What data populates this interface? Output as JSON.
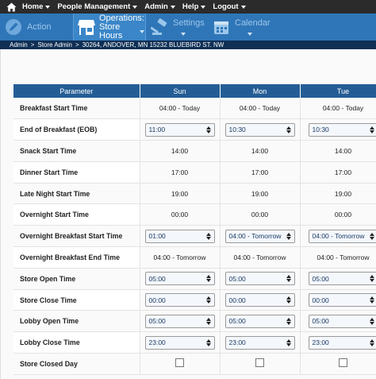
{
  "menu": {
    "home_icon": "home-icon",
    "items": [
      {
        "label": "Home",
        "has_caret": true
      },
      {
        "label": "People Management",
        "has_caret": true
      },
      {
        "label": "Admin",
        "has_caret": true
      },
      {
        "label": "Help",
        "has_caret": true
      },
      {
        "label": "Logout",
        "has_caret": true
      }
    ]
  },
  "toolbar": {
    "action_label": "Action",
    "operations_label_1": "Operations:",
    "operations_label_2": "Store Hours",
    "settings_label": "Settings",
    "calendar_label": "Calendar"
  },
  "breadcrumb": {
    "admin": "Admin",
    "sep1": ">",
    "store_admin": "Store Admin",
    "sep2": ">",
    "store": "30264, ANDOVER, MN 15232 BLUEBIRD ST. NW"
  },
  "table": {
    "headers": [
      "Parameter",
      "Sun",
      "Mon",
      "Tue"
    ],
    "rows": [
      {
        "label": "Breakfast Start Time",
        "type": "text",
        "values": [
          "04:00 - Today",
          "04:00 - Today",
          "04:00 - Today"
        ]
      },
      {
        "label": "End of Breakfast (EOB)",
        "type": "select",
        "values": [
          "11:00",
          "10:30",
          "10:30"
        ]
      },
      {
        "label": "Snack Start Time",
        "type": "text",
        "values": [
          "14:00",
          "14:00",
          "14:00"
        ]
      },
      {
        "label": "Dinner Start Time",
        "type": "text",
        "values": [
          "17:00",
          "17:00",
          "17:00"
        ]
      },
      {
        "label": "Late Night Start Time",
        "type": "text",
        "values": [
          "19:00",
          "19:00",
          "19:00"
        ]
      },
      {
        "label": "Overnight Start Time",
        "type": "text",
        "values": [
          "00:00",
          "00:00",
          "00:00"
        ]
      },
      {
        "label": "Overnight Breakfast Start Time",
        "type": "select",
        "values": [
          "01:00",
          "04:00 - Tomorrow",
          "04:00 - Tomorrow"
        ]
      },
      {
        "label": "Overnight Breakfast End Time",
        "type": "text",
        "values": [
          "04:00 - Tomorrow",
          "04:00 - Tomorrow",
          "04:00 - Tomorrow"
        ]
      },
      {
        "label": "Store Open Time",
        "type": "select",
        "values": [
          "05:00",
          "05:00",
          "05:00"
        ]
      },
      {
        "label": "Store Close Time",
        "type": "select",
        "values": [
          "00:00",
          "00:00",
          "00:00"
        ]
      },
      {
        "label": "Lobby Open Time",
        "type": "select",
        "values": [
          "05:00",
          "05:00",
          "05:00"
        ]
      },
      {
        "label": "Lobby Close Time",
        "type": "select",
        "values": [
          "23:00",
          "23:00",
          "23:00"
        ]
      },
      {
        "label": "Store Closed Day",
        "type": "checkbox",
        "values": [
          false,
          false,
          false
        ]
      }
    ]
  },
  "colors": {
    "menu_bg": "#2b2b2b",
    "toolbar_bg": "#2f76b8",
    "breadcrumb_bg": "#0f2f55",
    "table_header_bg": "#245d95"
  }
}
